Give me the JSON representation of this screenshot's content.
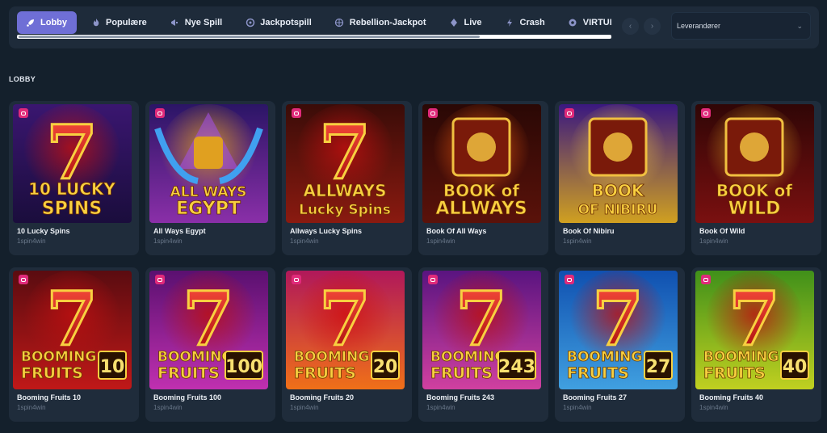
{
  "categories": [
    {
      "label": "Lobby",
      "icon": "rocket-icon",
      "active": true
    },
    {
      "label": "Populære",
      "icon": "flame-icon",
      "active": false
    },
    {
      "label": "Nye Spill",
      "icon": "megaphone-icon",
      "active": false
    },
    {
      "label": "Jackpotspill",
      "icon": "coin-icon",
      "active": false
    },
    {
      "label": "Rebellion-Jackpot",
      "icon": "globe-icon",
      "active": false
    },
    {
      "label": "Live",
      "icon": "diamond-icon",
      "active": false
    },
    {
      "label": "Crash",
      "icon": "lightning-icon",
      "active": false
    },
    {
      "label": "VIRTUELL SPO",
      "icon": "ball-icon",
      "active": false
    }
  ],
  "category_scroll": {
    "visible_fraction": 0.78
  },
  "provider_select": {
    "label": "Leverandører"
  },
  "section": {
    "title": "LOBBY"
  },
  "games": [
    {
      "name": "10 Lucky Spins",
      "provider": "1spin4win",
      "art": "Lucky",
      "art2": "SPINS",
      "num": "10",
      "bg1": "#3a1670",
      "bg2": "#1a0d3c",
      "glow": "#c01010"
    },
    {
      "name": "All Ways Egypt",
      "provider": "1spin4win",
      "art": "ALL WAYS",
      "art2": "EGYPT",
      "num": "",
      "bg1": "#2b1566",
      "bg2": "#8a2fa8",
      "glow": "#e0a020"
    },
    {
      "name": "Allways Lucky Spins",
      "provider": "1spin4win",
      "art": "ALLWAYS",
      "art2": "Lucky Spins",
      "num": "",
      "bg1": "#3a0c08",
      "bg2": "#8a1a10",
      "glow": "#c01010"
    },
    {
      "name": "Book Of All Ways",
      "provider": "1spin4win",
      "art": "BOOK of",
      "art2": "ALLWAYS",
      "num": "",
      "bg1": "#2a0805",
      "bg2": "#5a120a",
      "glow": "#ff6010"
    },
    {
      "name": "Book Of Nibiru",
      "provider": "1spin4win",
      "art": "BOOK",
      "art2": "OF NIBIRU",
      "num": "",
      "bg1": "#3a1880",
      "bg2": "#d0a020",
      "glow": "#f0c040"
    },
    {
      "name": "Book Of Wild",
      "provider": "1spin4win",
      "art": "BOOK of",
      "art2": "WILD",
      "num": "",
      "bg1": "#300606",
      "bg2": "#7a1010",
      "glow": "#e0a020"
    },
    {
      "name": "Booming Fruits 10",
      "provider": "1spin4win",
      "art": "BOOMING",
      "art2": "FRUITS",
      "num": "10",
      "bg1": "#5a0c10",
      "bg2": "#c01818",
      "glow": "#c01010"
    },
    {
      "name": "Booming Fruits 100",
      "provider": "1spin4win",
      "art": "BOOMING",
      "art2": "FRUITS",
      "num": "100",
      "bg1": "#5a1070",
      "bg2": "#c030b0",
      "glow": "#c01010"
    },
    {
      "name": "Booming Fruits 20",
      "provider": "1spin4win",
      "art": "BOOMING",
      "art2": "FRUITS",
      "num": "20",
      "bg1": "#b0185a",
      "bg2": "#f07018",
      "glow": "#d01010"
    },
    {
      "name": "Booming Fruits 243",
      "provider": "1spin4win",
      "art": "BOOMING",
      "art2": "FRUITS",
      "num": "243",
      "bg1": "#5a1480",
      "bg2": "#d040a0",
      "glow": "#c01010"
    },
    {
      "name": "Booming Fruits 27",
      "provider": "1spin4win",
      "art": "BOOMING",
      "art2": "FRUITS",
      "num": "27",
      "bg1": "#1050b0",
      "bg2": "#40a0e0",
      "glow": "#c01010"
    },
    {
      "name": "Booming Fruits 40",
      "provider": "1spin4win",
      "art": "BOOMING",
      "art2": "FRUITS",
      "num": "40",
      "bg1": "#40901a",
      "bg2": "#c0d020",
      "glow": "#c01010"
    }
  ]
}
